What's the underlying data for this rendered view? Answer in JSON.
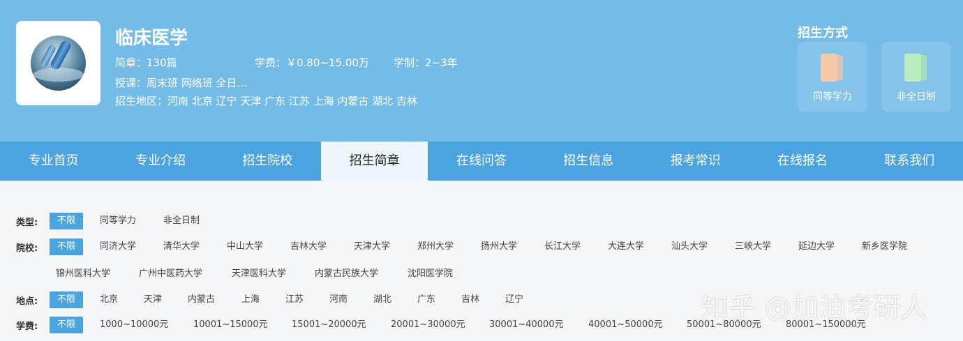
{
  "header": {
    "title": "临床医学",
    "brochures": "简章：130篇",
    "tuition": "学费：￥0.80~15.00万",
    "duration": "学制：2~3年",
    "teaching": "授课：周末班 网络班 全日...",
    "regions": "招生地区：河南 北京 辽宁 天津 广东 江苏 上海 内蒙古 湖北 吉林",
    "enroll_title": "招生方式",
    "modes": [
      {
        "label": "同等学力",
        "icon": "orange-book-icon"
      },
      {
        "label": "非全日制",
        "icon": "green-book-icon"
      }
    ]
  },
  "nav": {
    "items": [
      "专业首页",
      "专业介绍",
      "招生院校",
      "招生简章",
      "在线问答",
      "招生信息",
      "报考常识",
      "在线报名",
      "联系我们"
    ],
    "active": "招生简章"
  },
  "filters": {
    "type": {
      "label": "类型:",
      "options": [
        "不限",
        "同等学力",
        "非全日制"
      ]
    },
    "school": {
      "label": "院校:",
      "options": [
        "不限",
        "同济大学",
        "清华大学",
        "中山大学",
        "吉林大学",
        "天津大学",
        "郑州大学",
        "扬州大学",
        "长江大学",
        "大连大学",
        "汕头大学",
        "三峡大学",
        "延边大学",
        "新乡医学院"
      ],
      "options_row2": [
        "锦州医科大学",
        "广州中医药大学",
        "天津医科大学",
        "内蒙古民族大学",
        "沈阳医学院"
      ]
    },
    "location": {
      "label": "地点:",
      "options": [
        "不限",
        "北京",
        "天津",
        "内蒙古",
        "上海",
        "江苏",
        "河南",
        "湖北",
        "广东",
        "吉林",
        "辽宁"
      ]
    },
    "fee": {
      "label": "学费:",
      "options": [
        "不限",
        "1000~10000元",
        "10001~15000元",
        "15001~20000元",
        "20001~30000元",
        "30001~40000元",
        "40001~50000元",
        "50001~80000元",
        "80001~150000元"
      ]
    }
  },
  "watermark": "知乎 @加油考研人",
  "colors": {
    "header_bg": "#74bbe8",
    "nav_bg": "#4ba4e0",
    "selected_bg": "#4ba4e0"
  }
}
